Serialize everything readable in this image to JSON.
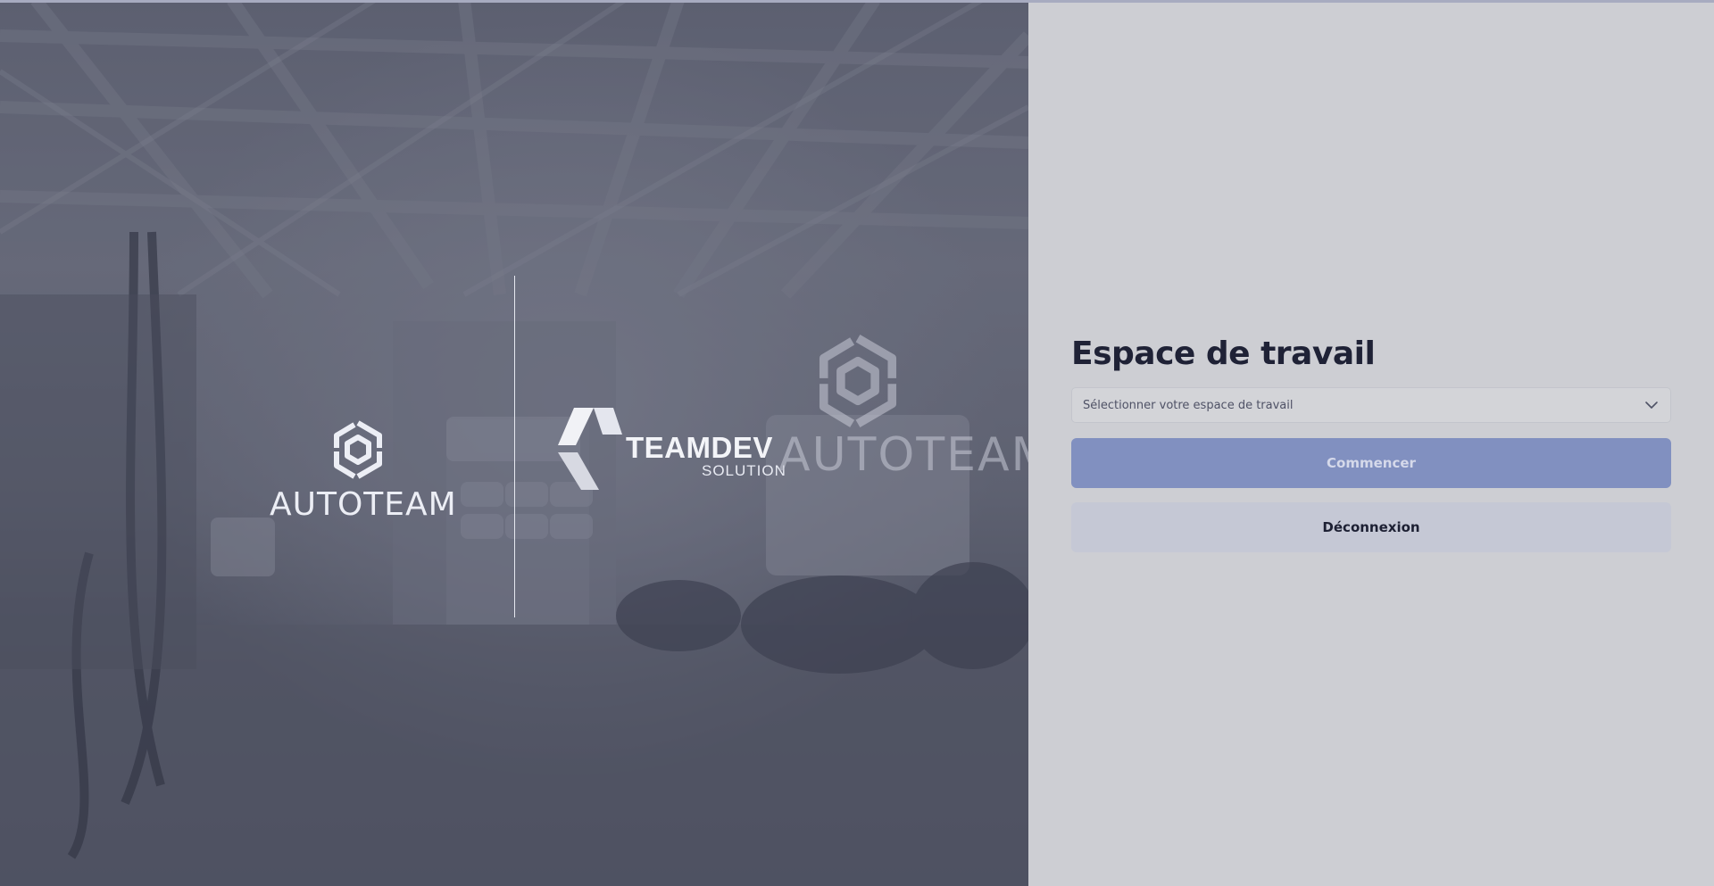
{
  "hero": {
    "left_logo": {
      "wordmark": "AUTOTEAM",
      "icon": "autoteam-hexagon-icon"
    },
    "center_logo": {
      "wordmark": "TEAMDEV",
      "tagline": "SOLUTION",
      "icon": "teamdev-chevron-icon"
    },
    "watermark": {
      "wordmark": "AUTOTEAM",
      "icon": "autoteam-hexagon-icon"
    }
  },
  "workspace": {
    "title": "Espace de travail",
    "select": {
      "placeholder": "Sélectionner votre espace de travail",
      "icon": "chevron-down-icon"
    },
    "start_button": "Commencer",
    "logout_button": "Déconnexion"
  },
  "colors": {
    "panel_bg": "#cdced3",
    "title": "#1f2236",
    "primary_button": "#8190c0",
    "secondary_button": "#c5c8d5"
  }
}
